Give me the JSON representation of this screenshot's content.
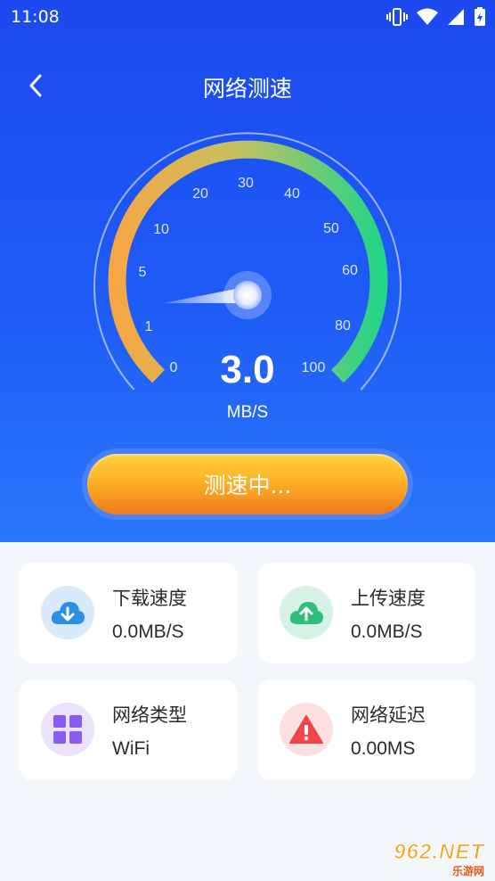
{
  "status": {
    "time": "11:08"
  },
  "header": {
    "title": "网络测速"
  },
  "gauge": {
    "ticks": [
      "0",
      "1",
      "5",
      "10",
      "20",
      "30",
      "40",
      "50",
      "60",
      "80",
      "100"
    ],
    "value": "3.0",
    "unit": "MB/S"
  },
  "action": {
    "label": "测速中..."
  },
  "cards": [
    {
      "label": "下载速度",
      "value": "0.0MB/S",
      "icon": "download-cloud-icon",
      "color": "#2c8fe6",
      "bg": "#d8eaf9"
    },
    {
      "label": "上传速度",
      "value": "0.0MB/S",
      "icon": "upload-cloud-icon",
      "color": "#2fbf7a",
      "bg": "#d6f2e5"
    },
    {
      "label": "网络类型",
      "value": "WiFi",
      "icon": "grid-icon",
      "color": "#8a5cf0",
      "bg": "#ebe2fb"
    },
    {
      "label": "网络延迟",
      "value": "0.00MS",
      "icon": "warning-icon",
      "color": "#f0454b",
      "bg": "#fde0e0"
    }
  ],
  "watermark": {
    "text": "962.NET",
    "sub": "乐游网"
  }
}
